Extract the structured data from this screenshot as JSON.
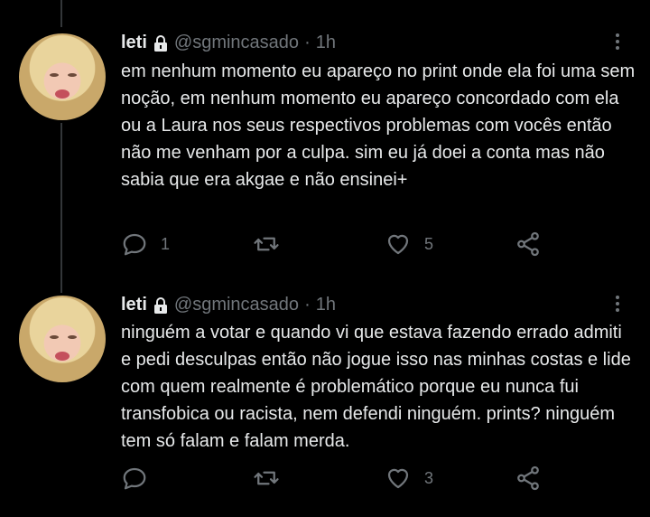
{
  "tweets": [
    {
      "name": "leti",
      "handle": "@sgmincasado",
      "separator": "·",
      "time": "1h",
      "text": "em nenhum momento eu apareço no print onde ela foi uma sem noção, em nenhum momento eu apareço concordado com ela ou a Laura nos seus respectivos problemas com vocês então não me venham por a culpa. sim eu já doei a conta mas não sabia que era akgae e não ensinei+",
      "reply_count": "1",
      "retweet_count": "",
      "like_count": "5"
    },
    {
      "name": "leti",
      "handle": "@sgmincasado",
      "separator": "·",
      "time": "1h",
      "text": "ninguém a votar e quando vi que estava fazendo errado admiti e pedi desculpas então não jogue isso nas minhas costas e lide com quem realmente é problemático porque eu nunca fui transfobica ou racista, nem defendi ninguém. prints? ninguém tem só falam e falam merda.",
      "reply_count": "",
      "retweet_count": "",
      "like_count": "3"
    }
  ],
  "icons": {
    "reply": "reply-icon",
    "retweet": "retweet-icon",
    "like": "heart-icon",
    "share": "share-icon",
    "more": "more-icon",
    "lock": "lock-icon"
  },
  "colors": {
    "background": "#000000",
    "text": "#e7e9ea",
    "muted": "#71767b",
    "thread_line": "#333639"
  }
}
